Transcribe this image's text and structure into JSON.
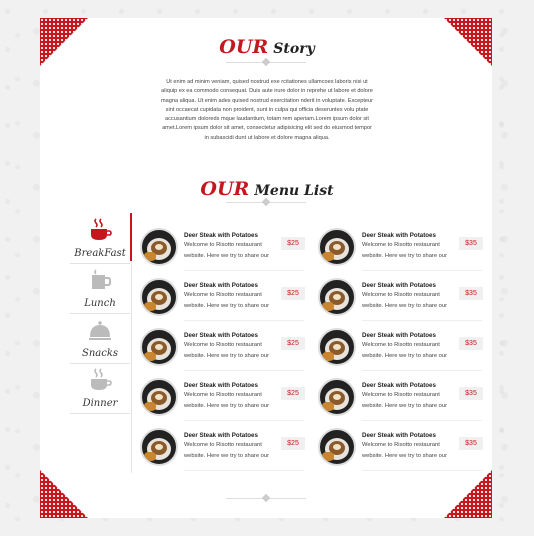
{
  "colors": {
    "accent": "#c6171e",
    "card": "#ffffff",
    "background": "#f1f1f1"
  },
  "story": {
    "title_accent": "OUR",
    "title_rest": "Story",
    "text": "Ut enim ad minim veniam, quised nostrud exe rcitationes ullamcoes laboris nisi ut aliquip ex ea commodo consequat. Duis aute irure dolor in reprehe ut labore et dolore magna aliqua. Ut enim ades quised nostrud exercitation nderit in voluptate. Excepteur sint occaecat cupidata non proident, sunt in culpa qui officia deseruntes volu ptate accusantium doloreds mque laudantium, totam rem aperiam.Lorem ipsum dolor sit amet.Lorem ipsum dolor sit amet, consectetur adipisicing elit sed do eiusmod tempor in subascidi dunt ut labore et dolore magna aliqua."
  },
  "menu": {
    "title_accent": "OUR",
    "title_rest": "Menu List",
    "tabs": [
      {
        "label": "BreakFast",
        "icon": "coffee-cup-icon",
        "active": true
      },
      {
        "label": "Lunch",
        "icon": "mug-icon",
        "active": false
      },
      {
        "label": "Snacks",
        "icon": "cloche-icon",
        "active": false
      },
      {
        "label": "Dinner",
        "icon": "coffee-cup-icon",
        "active": false
      }
    ],
    "items": [
      {
        "name": "Deer Steak with Potatoes",
        "desc": "Welcome to Risotto restaurant website. Here we try to share our",
        "price": "$25"
      },
      {
        "name": "Deer Steak with Potatoes",
        "desc": "Welcome to Risotto restaurant website. Here we try to share our",
        "price": "$35"
      },
      {
        "name": "Deer Steak with Potatoes",
        "desc": "Welcome to Risotto restaurant website. Here we try to share our",
        "price": "$25"
      },
      {
        "name": "Deer Steak with Potatoes",
        "desc": "Welcome to Risotto restaurant website. Here we try to share our",
        "price": "$35"
      },
      {
        "name": "Deer Steak with Potatoes",
        "desc": "Welcome to Risotto restaurant website. Here we try to share our",
        "price": "$25"
      },
      {
        "name": "Deer Steak with Potatoes",
        "desc": "Welcome to Risotto restaurant website. Here we try to share our",
        "price": "$35"
      },
      {
        "name": "Deer Steak with Potatoes",
        "desc": "Welcome to Risotto restaurant website. Here we try to share our",
        "price": "$25"
      },
      {
        "name": "Deer Steak with Potatoes",
        "desc": "Welcome to Risotto restaurant website. Here we try to share our",
        "price": "$35"
      },
      {
        "name": "Deer Steak with Potatoes",
        "desc": "Welcome to Risotto restaurant website. Here we try to share our",
        "price": "$25"
      },
      {
        "name": "Deer Steak with Potatoes",
        "desc": "Welcome to Risotto restaurant website. Here we try to share our",
        "price": "$35"
      }
    ]
  }
}
